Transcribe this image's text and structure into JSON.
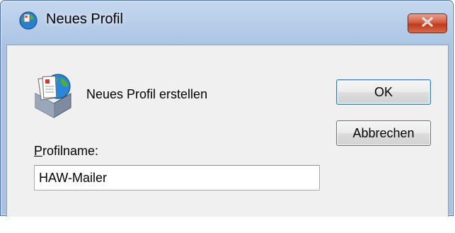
{
  "window": {
    "title": "Neues Profil",
    "title_icon": "outlook-profile-icon",
    "close_icon": "close-icon"
  },
  "dialog": {
    "header_icon": "mail-profile-icon",
    "header_text": "Neues Profil erstellen",
    "field_label_mnemonic": "P",
    "field_label_rest": "rofilname:",
    "profile_name_value": "HAW-Mailer",
    "ok_label": "OK",
    "cancel_label": "Abbrechen"
  },
  "colors": {
    "titlebar": "#b4cbe8",
    "close_button": "#c8452a",
    "client_background": "#f0f0f0"
  }
}
